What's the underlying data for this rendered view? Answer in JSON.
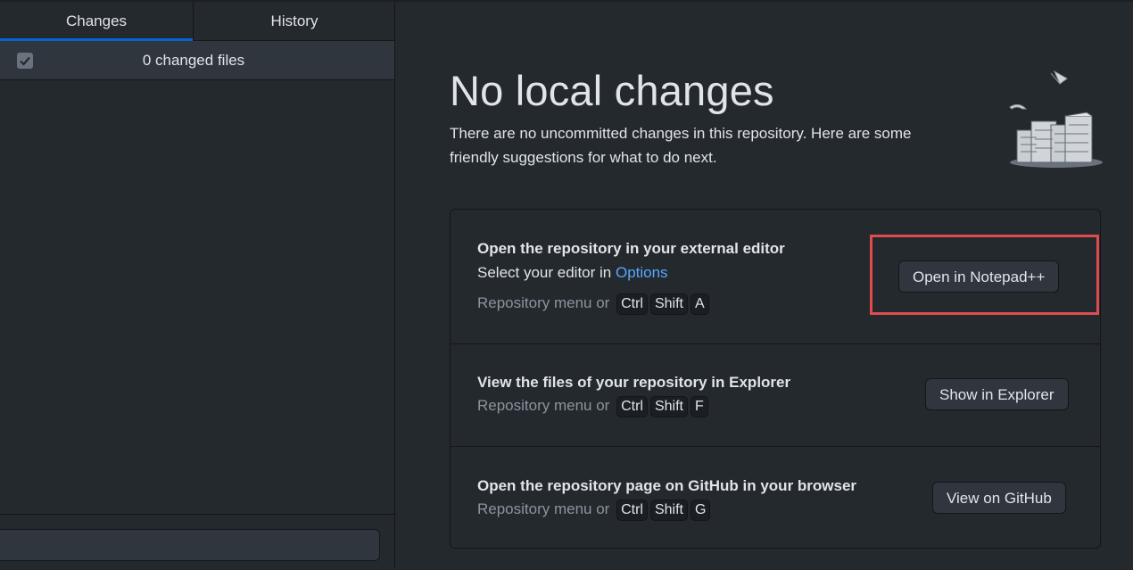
{
  "sidebar": {
    "tabs": [
      {
        "label": "Changes",
        "active": true
      },
      {
        "label": "History",
        "active": false
      }
    ],
    "changed_files_label": "0 changed files",
    "select_all_checked": true
  },
  "main": {
    "title": "No local changes",
    "subtitle": "There are no uncommitted changes in this repository. Here are some friendly suggestions for what to do next.",
    "suggestions": [
      {
        "title": "Open the repository in your external editor",
        "description_prefix": "Select your editor in ",
        "description_link": "Options",
        "shortcut_prefix": "Repository menu or",
        "keys": [
          "Ctrl",
          "Shift",
          "A"
        ],
        "button": "Open in Notepad++",
        "highlighted": true
      },
      {
        "title": "View the files of your repository in Explorer",
        "shortcut_prefix": "Repository menu or",
        "keys": [
          "Ctrl",
          "Shift",
          "F"
        ],
        "button": "Show in Explorer"
      },
      {
        "title": "Open the repository page on GitHub in your browser",
        "shortcut_prefix": "Repository menu or",
        "keys": [
          "Ctrl",
          "Shift",
          "G"
        ],
        "button": "View on GitHub"
      }
    ]
  },
  "colors": {
    "background": "#24292e",
    "tab_underline": "#0366d6",
    "link": "#58a6ff",
    "highlight_border": "#e04c4c"
  }
}
